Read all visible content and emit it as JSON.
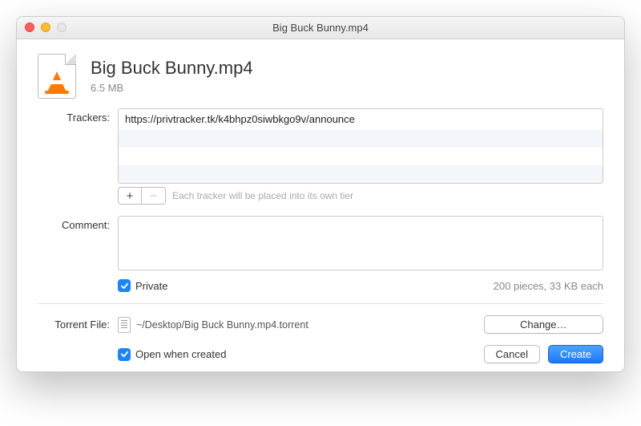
{
  "window": {
    "title": "Big Buck Bunny.mp4"
  },
  "file": {
    "name": "Big Buck Bunny.mp4",
    "size": "6.5 MB"
  },
  "labels": {
    "trackers": "Trackers:",
    "comment": "Comment:",
    "torrent_file": "Torrent File:"
  },
  "trackers": {
    "rows": [
      "https://privtracker.tk/k4bhpz0siwbkgo9v/announce"
    ],
    "add_label": "+",
    "remove_label": "−",
    "hint": "Each tracker will be placed into its own tier"
  },
  "comment": {
    "value": ""
  },
  "private": {
    "label": "Private",
    "checked": true
  },
  "pieces_info": "200 pieces, 33 KB each",
  "torrent_file": {
    "path": "~/Desktop/Big Buck Bunny.mp4.torrent",
    "change_label": "Change…"
  },
  "open_when_created": {
    "label": "Open when created",
    "checked": true
  },
  "buttons": {
    "cancel": "Cancel",
    "create": "Create"
  }
}
